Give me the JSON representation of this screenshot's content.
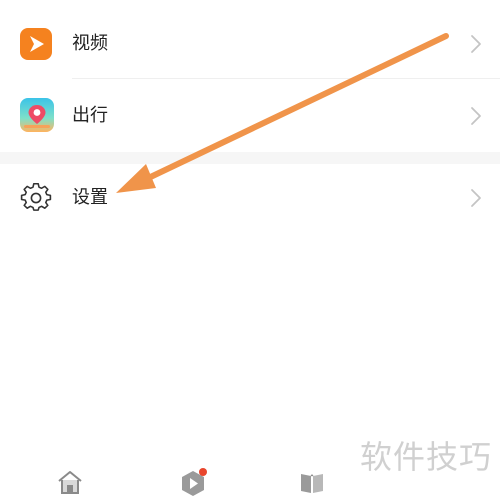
{
  "menu": {
    "items": [
      {
        "label": "视频",
        "icon": "video-app-icon"
      },
      {
        "label": "出行",
        "icon": "travel-app-icon"
      },
      {
        "label": "设置",
        "icon": "settings-gear-icon"
      }
    ]
  },
  "bottom_nav": {
    "items": [
      {
        "icon": "home-icon"
      },
      {
        "icon": "video-play-icon",
        "badge": "red-dot"
      },
      {
        "icon": "book-icon"
      }
    ]
  },
  "watermark": "软件技巧",
  "annotation": {
    "arrow_color": "#f0944a",
    "points_to": "设置"
  },
  "colors": {
    "video_icon": "#f5821f",
    "badge": "#e8452c",
    "arrow": "#f0944a"
  }
}
